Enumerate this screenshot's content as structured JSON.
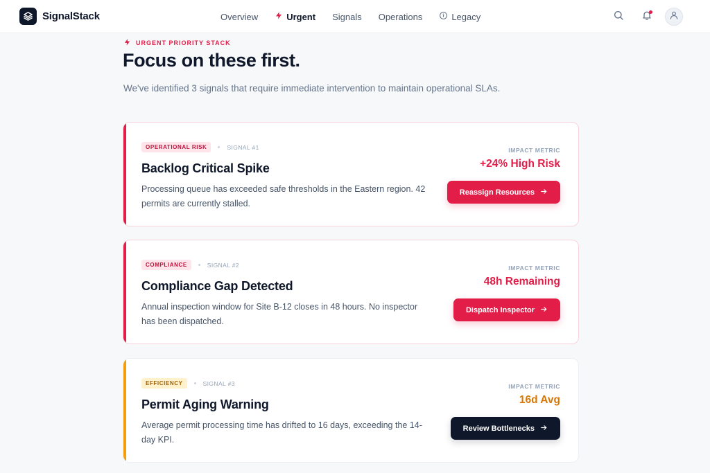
{
  "app": {
    "brand": "SignalStack"
  },
  "nav": {
    "items": [
      {
        "label": "Overview",
        "icon": null,
        "active": false
      },
      {
        "label": "Urgent",
        "icon": "bolt-icon",
        "active": true
      },
      {
        "label": "Signals",
        "icon": null,
        "active": false
      },
      {
        "label": "Operations",
        "icon": null,
        "active": false
      },
      {
        "label": "Legacy",
        "icon": "info-circle-icon",
        "active": false
      }
    ]
  },
  "header_actions": {
    "icons": [
      "search-icon",
      "bell-icon",
      "user-avatar-icon"
    ],
    "bell_has_notification": true
  },
  "hero": {
    "eyebrow": "URGENT PRIORITY STACK",
    "title": "Focus on these first.",
    "subtitle": "We've identified 3 signals that require immediate intervention to maintain operational SLAs."
  },
  "cards": [
    {
      "tag": "OPERATIONAL RISK",
      "tag_color": "#be123c",
      "signal": "SIGNAL #1",
      "title": "Backlog Critical Spike",
      "description": "Processing queue has exceeded safe thresholds in the Eastern region. 42 permits are currently stalled.",
      "metric_label": "IMPACT METRIC",
      "metric_value": "+24% High Risk",
      "action": "Reassign Resources"
    },
    {
      "tag": "COMPLIANCE",
      "tag_color": "#be123c",
      "signal": "SIGNAL #2",
      "title": "Compliance Gap Detected",
      "description": "Annual inspection window for Site B-12 closes in 48 hours. No inspector has been dispatched.",
      "metric_label": "IMPACT METRIC",
      "metric_value": "48h Remaining",
      "action": "Dispatch Inspector"
    },
    {
      "tag": "EFFICIENCY",
      "tag_color": "#a16207",
      "signal": "SIGNAL #3",
      "title": "Permit Aging Warning",
      "description": "Average permit processing time has drifted to 16 days, exceeding the 14-day KPI.",
      "metric_label": "IMPACT METRIC",
      "metric_value": "16d Avg",
      "action": "Review Bottlenecks"
    }
  ],
  "colors": {
    "accent_red": "#e11d48",
    "accent_amber": "#f59e0b",
    "dark": "#0f172a"
  }
}
